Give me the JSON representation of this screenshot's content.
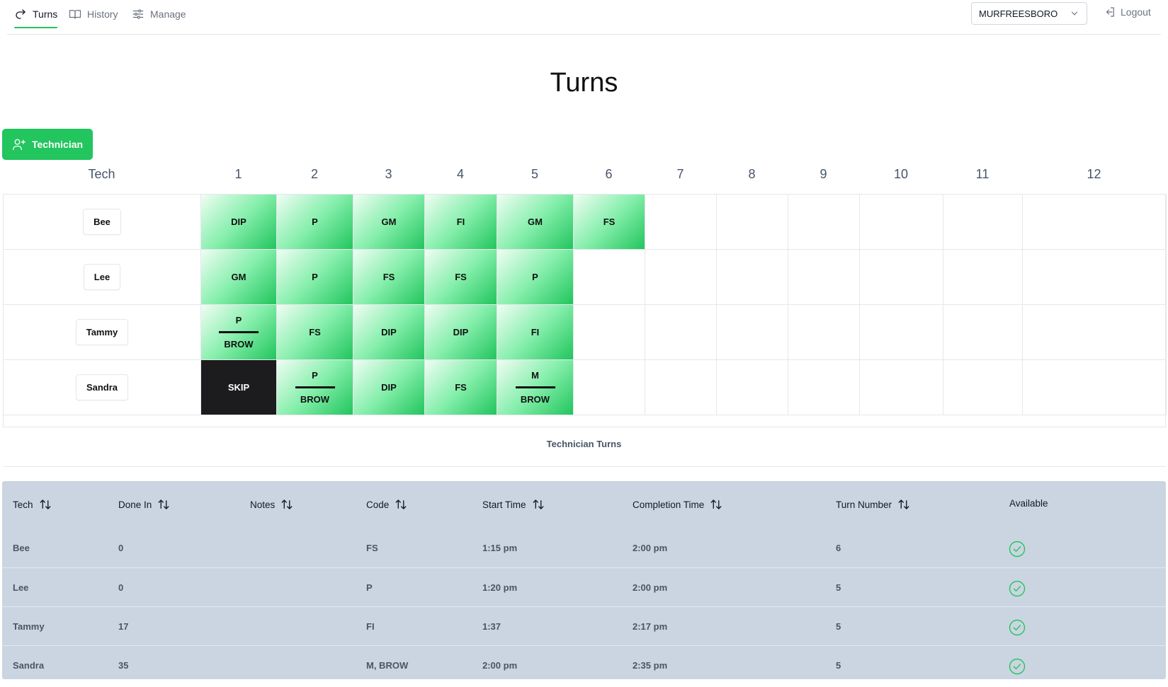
{
  "nav": {
    "tabs": [
      {
        "label": "Turns",
        "icon": "redo-arrow-icon",
        "active": true
      },
      {
        "label": "History",
        "icon": "book-open-icon",
        "active": false
      },
      {
        "label": "Manage",
        "icon": "sliders-icon",
        "active": false
      }
    ],
    "store_select": "MURFREESBORO",
    "logout_label": "Logout"
  },
  "page": {
    "title": "Turns",
    "add_button_label": "Technician"
  },
  "grid": {
    "tech_header": "Tech",
    "turn_headers": [
      "1",
      "2",
      "3",
      "4",
      "5",
      "6",
      "7",
      "8",
      "9",
      "10",
      "11",
      "12"
    ],
    "rows": [
      {
        "tech": "Bee",
        "turns": [
          {
            "top": "DIP"
          },
          {
            "top": "P"
          },
          {
            "top": "GM"
          },
          {
            "top": "FI"
          },
          {
            "top": "GM"
          },
          {
            "top": "FS"
          }
        ]
      },
      {
        "tech": "Lee",
        "turns": [
          {
            "top": "GM"
          },
          {
            "top": "P"
          },
          {
            "top": "FS"
          },
          {
            "top": "FS"
          },
          {
            "top": "P"
          }
        ]
      },
      {
        "tech": "Tammy",
        "turns": [
          {
            "top": "P",
            "bottom": "BROW"
          },
          {
            "top": "FS"
          },
          {
            "top": "DIP"
          },
          {
            "top": "DIP"
          },
          {
            "top": "FI"
          }
        ]
      },
      {
        "tech": "Sandra",
        "turns": [
          {
            "top": "SKIP",
            "skip": true
          },
          {
            "top": "P",
            "bottom": "BROW"
          },
          {
            "top": "DIP"
          },
          {
            "top": "FS"
          },
          {
            "top": "M",
            "bottom": "BROW"
          }
        ]
      }
    ],
    "caption": "Technician Turns",
    "turn_color": "#22c55e",
    "skip_color": "#1c1c1e"
  },
  "table": {
    "headers": [
      "Tech",
      "Done In",
      "Notes",
      "Code",
      "Start Time",
      "Completion Time",
      "Turn Number",
      "Available"
    ],
    "rows": [
      {
        "tech": "Bee",
        "done_in": "0",
        "notes": "",
        "code": "FS",
        "start": "1:15 pm",
        "completion": "2:00 pm",
        "turn_number": "6",
        "available": true
      },
      {
        "tech": "Lee",
        "done_in": "0",
        "notes": "",
        "code": "P",
        "start": "1:20 pm",
        "completion": "2:00 pm",
        "turn_number": "5",
        "available": true
      },
      {
        "tech": "Tammy",
        "done_in": "17",
        "notes": "",
        "code": "FI",
        "start": "1:37",
        "completion": "2:17 pm",
        "turn_number": "5",
        "available": true
      },
      {
        "tech": "Sandra",
        "done_in": "35",
        "notes": "",
        "code": "M, BROW",
        "start": "2:00 pm",
        "completion": "2:35 pm",
        "turn_number": "5",
        "available": true
      }
    ],
    "available_icon": "check-circle-icon",
    "available_color": "#22c55e"
  }
}
